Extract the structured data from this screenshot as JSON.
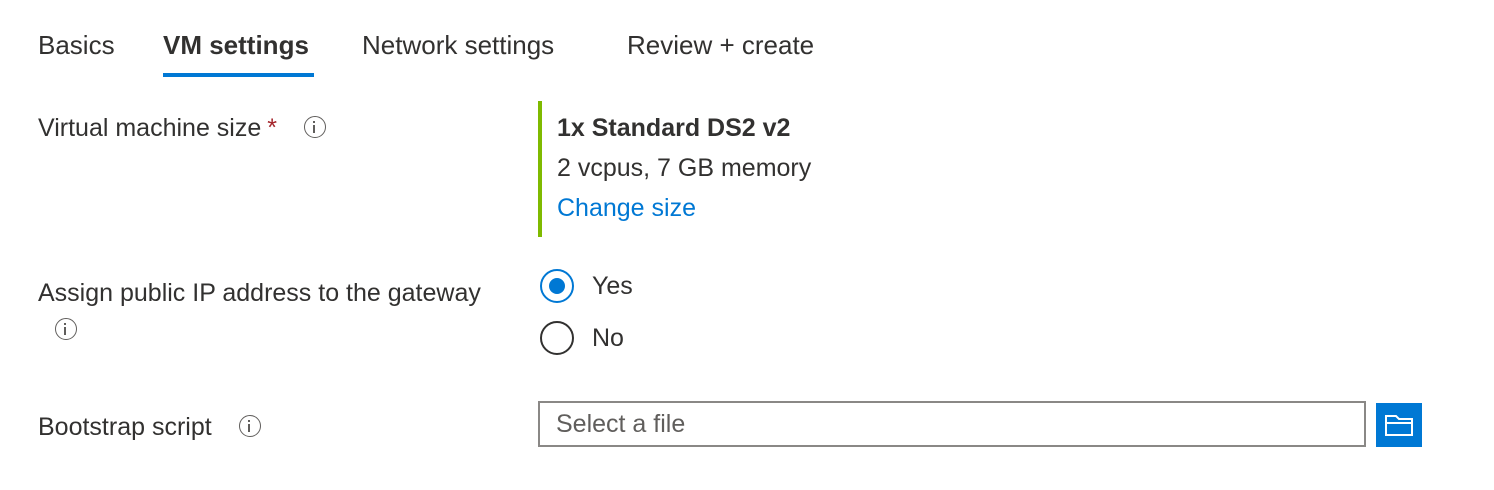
{
  "tabs": [
    {
      "label": "Basics",
      "active": false
    },
    {
      "label": "VM settings",
      "active": true
    },
    {
      "label": "Network settings",
      "active": false
    },
    {
      "label": "Review + create",
      "active": false
    }
  ],
  "vm_size": {
    "label": "Virtual machine size",
    "required_marker": "*",
    "info_icon": "info-icon",
    "selected_name": "1x Standard DS2 v2",
    "selected_desc": "2 vcpus, 7 GB memory",
    "change_link": "Change size"
  },
  "public_ip": {
    "label": "Assign public IP address to the gateway",
    "info_icon": "info-icon",
    "options": [
      {
        "label": "Yes",
        "checked": true
      },
      {
        "label": "No",
        "checked": false
      }
    ]
  },
  "bootstrap": {
    "label": "Bootstrap script",
    "info_icon": "info-icon",
    "placeholder": "Select a file",
    "value": "",
    "browse_icon": "folder-icon"
  },
  "colors": {
    "accent": "#0078d4",
    "size_bar": "#7fba00",
    "required": "#a4262c",
    "text": "#323130"
  }
}
